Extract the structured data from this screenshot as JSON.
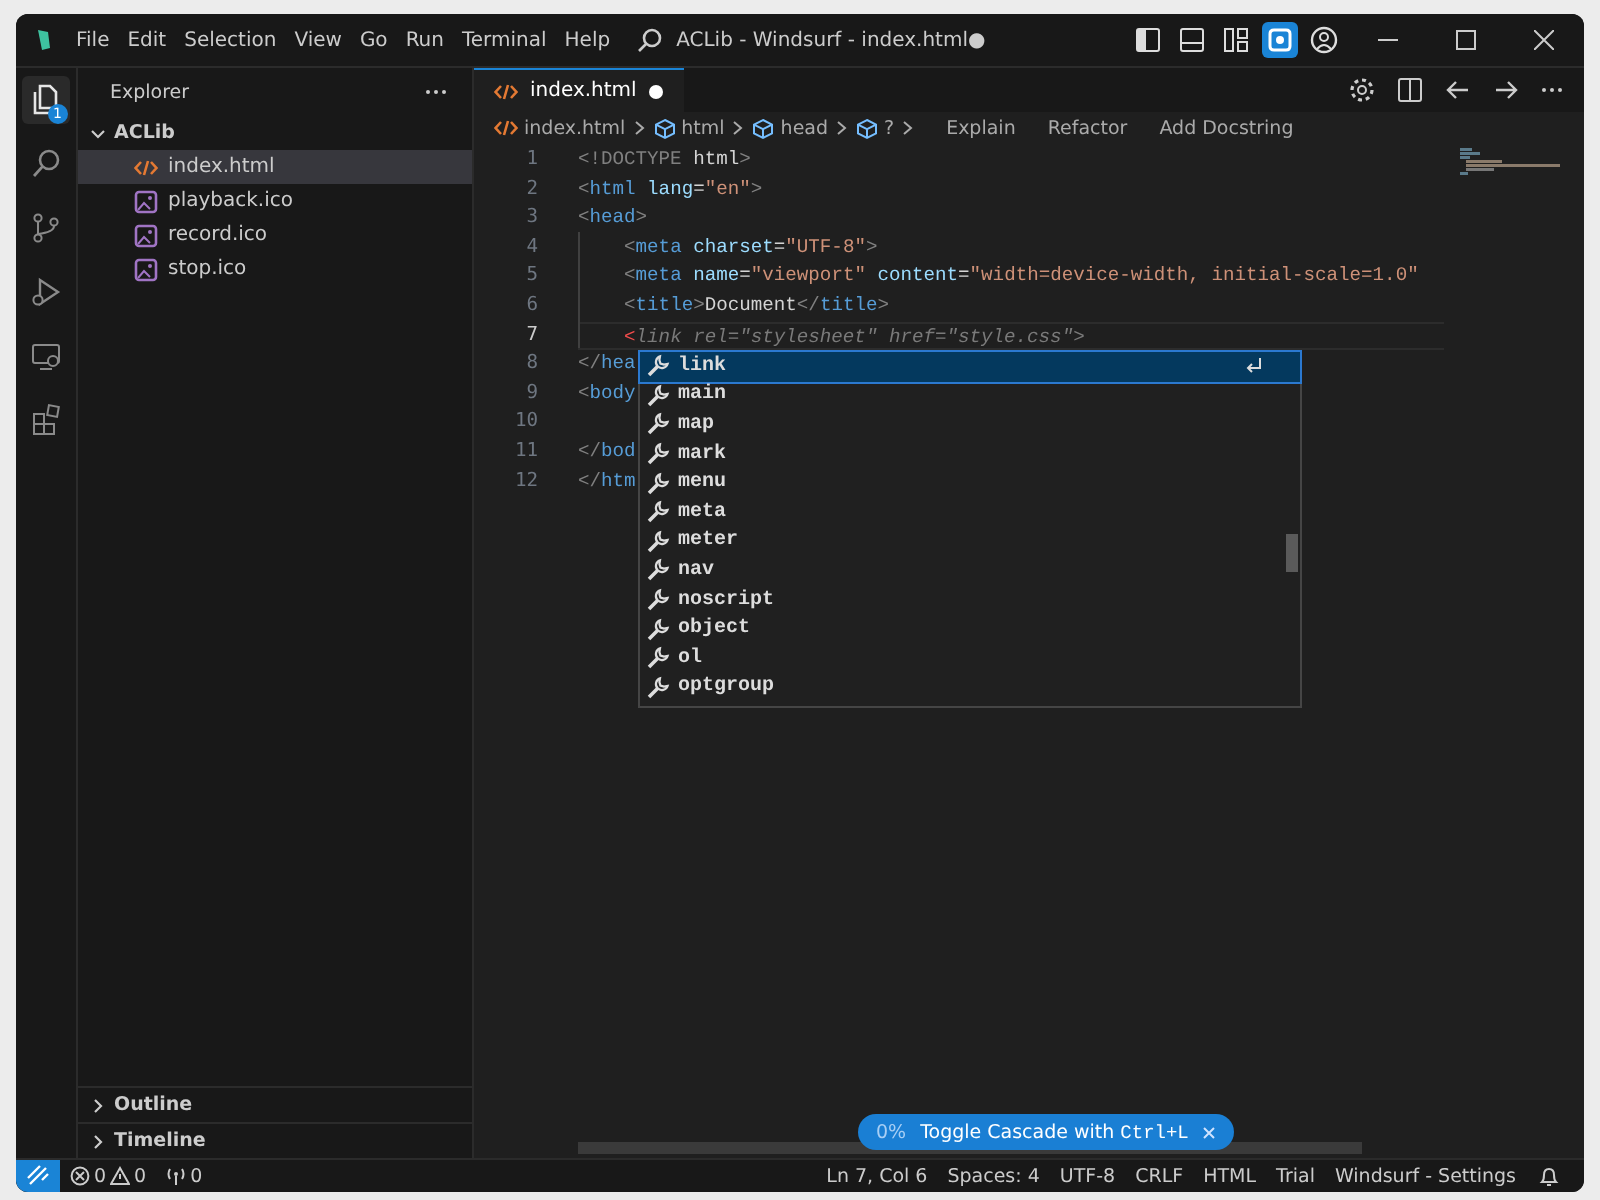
{
  "title_bar": {
    "menu": [
      "File",
      "Edit",
      "Selection",
      "View",
      "Go",
      "Run",
      "Terminal",
      "Help"
    ],
    "title": "ACLib - Windsurf - index.html●",
    "layout_buttons": [
      {
        "kind": "sidebar",
        "selected": false
      },
      {
        "kind": "panel",
        "selected": false
      },
      {
        "kind": "layout",
        "selected": false
      },
      {
        "kind": "cascade",
        "selected": true
      },
      {
        "kind": "account",
        "selected": false
      }
    ]
  },
  "activity_bar": [
    {
      "kind": "files",
      "selected": true,
      "badge": "1"
    },
    {
      "kind": "search",
      "selected": false
    },
    {
      "kind": "branch",
      "selected": false
    },
    {
      "kind": "run",
      "selected": false
    },
    {
      "kind": "remote",
      "selected": false
    },
    {
      "kind": "extensions",
      "selected": false
    }
  ],
  "sidebar": {
    "title": "Explorer",
    "folder": {
      "name": "ACLib",
      "expanded": true,
      "children": [
        {
          "name": "index.html",
          "kind": "html",
          "selected": true
        },
        {
          "name": "playback.ico",
          "kind": "image",
          "selected": false
        },
        {
          "name": "record.ico",
          "kind": "image",
          "selected": false
        },
        {
          "name": "stop.ico",
          "kind": "image",
          "selected": false
        }
      ]
    },
    "sections": [
      {
        "name": "Outline",
        "expanded": false
      },
      {
        "name": "Timeline",
        "expanded": false
      }
    ]
  },
  "tabs": [
    {
      "label": "index.html",
      "selected": true,
      "modified": true
    }
  ],
  "breadcrumbs": [
    {
      "label": "index.html",
      "kind": "file"
    },
    {
      "label": "html",
      "kind": "symbol"
    },
    {
      "label": "head",
      "kind": "symbol"
    },
    {
      "label": "?",
      "kind": "symbol"
    }
  ],
  "code_actions": [
    "Explain",
    "Refactor",
    "Add Docstring"
  ],
  "editor": {
    "lines": [
      {
        "number": "1",
        "current": false,
        "segments": [
          {
            "kind": "punct",
            "text": "<!DOCTYPE"
          },
          {
            "kind": "text",
            "text": " html"
          },
          {
            "kind": "punct",
            "text": ">"
          }
        ]
      },
      {
        "number": "2",
        "current": false,
        "segments": [
          {
            "kind": "punct",
            "text": "<"
          },
          {
            "kind": "tag",
            "text": "html"
          },
          {
            "kind": "attr",
            "text": " lang"
          },
          {
            "kind": "text",
            "text": "="
          },
          {
            "kind": "string",
            "text": "\"en\""
          },
          {
            "kind": "punct",
            "text": ">"
          }
        ]
      },
      {
        "number": "3",
        "current": false,
        "segments": [
          {
            "kind": "punct",
            "text": "<"
          },
          {
            "kind": "tag",
            "text": "head"
          },
          {
            "kind": "punct",
            "text": ">"
          }
        ]
      },
      {
        "number": "4",
        "current": false,
        "segments": [
          {
            "kind": "punct",
            "text": "    <"
          },
          {
            "kind": "tag",
            "text": "meta"
          },
          {
            "kind": "attr",
            "text": " charset"
          },
          {
            "kind": "text",
            "text": "="
          },
          {
            "kind": "string",
            "text": "\"UTF-8\""
          },
          {
            "kind": "punct",
            "text": ">"
          }
        ]
      },
      {
        "number": "5",
        "current": false,
        "segments": [
          {
            "kind": "punct",
            "text": "    <"
          },
          {
            "kind": "tag",
            "text": "meta"
          },
          {
            "kind": "attr",
            "text": " name"
          },
          {
            "kind": "text",
            "text": "="
          },
          {
            "kind": "string",
            "text": "\"viewport\""
          },
          {
            "kind": "attr",
            "text": " content"
          },
          {
            "kind": "text",
            "text": "="
          },
          {
            "kind": "string",
            "text": "\"width=device-width, initial-scale=1.0\""
          }
        ]
      },
      {
        "number": "6",
        "current": false,
        "segments": [
          {
            "kind": "punct",
            "text": "    <"
          },
          {
            "kind": "tag",
            "text": "title"
          },
          {
            "kind": "punct",
            "text": ">"
          },
          {
            "kind": "text",
            "text": "Document"
          },
          {
            "kind": "punct",
            "text": "</"
          },
          {
            "kind": "tag",
            "text": "title"
          },
          {
            "kind": "punct",
            "text": ">"
          }
        ]
      },
      {
        "number": "7",
        "current": true,
        "segments": [
          {
            "kind": "error",
            "text": "    <"
          },
          {
            "kind": "ghost",
            "text": "link rel=\"stylesheet\" href=\"style.css\">"
          }
        ]
      },
      {
        "number": "8",
        "current": false,
        "segments": [
          {
            "kind": "punct",
            "text": "</"
          },
          {
            "kind": "tag",
            "text": "hea"
          }
        ]
      },
      {
        "number": "9",
        "current": false,
        "segments": [
          {
            "kind": "punct",
            "text": "<"
          },
          {
            "kind": "tag",
            "text": "body"
          }
        ]
      },
      {
        "number": "10",
        "current": false
      },
      {
        "number": "11",
        "current": false,
        "segments": [
          {
            "kind": "punct",
            "text": "</"
          },
          {
            "kind": "tag",
            "text": "bod"
          }
        ]
      },
      {
        "number": "12",
        "current": false,
        "segments": [
          {
            "kind": "punct",
            "text": "</"
          },
          {
            "kind": "tag",
            "text": "htm"
          }
        ]
      }
    ]
  },
  "suggestions": [
    {
      "label": "link",
      "selected": true
    },
    {
      "label": "main",
      "selected": false
    },
    {
      "label": "map",
      "selected": false
    },
    {
      "label": "mark",
      "selected": false
    },
    {
      "label": "menu",
      "selected": false
    },
    {
      "label": "meta",
      "selected": false
    },
    {
      "label": "meter",
      "selected": false
    },
    {
      "label": "nav",
      "selected": false
    },
    {
      "label": "noscript",
      "selected": false
    },
    {
      "label": "object",
      "selected": false
    },
    {
      "label": "ol",
      "selected": false
    },
    {
      "label": "optgroup",
      "selected": false
    }
  ],
  "toast": {
    "progress": "0%",
    "text": "Toggle Cascade with",
    "shortcut": "Ctrl+L"
  },
  "status_bar": {
    "errors": "0",
    "warnings": "0",
    "ports": "0",
    "items": [
      "Ln 7, Col 6",
      "Spaces: 4",
      "UTF-8",
      "CRLF",
      "HTML",
      "Trial",
      "Windsurf - Settings"
    ]
  }
}
